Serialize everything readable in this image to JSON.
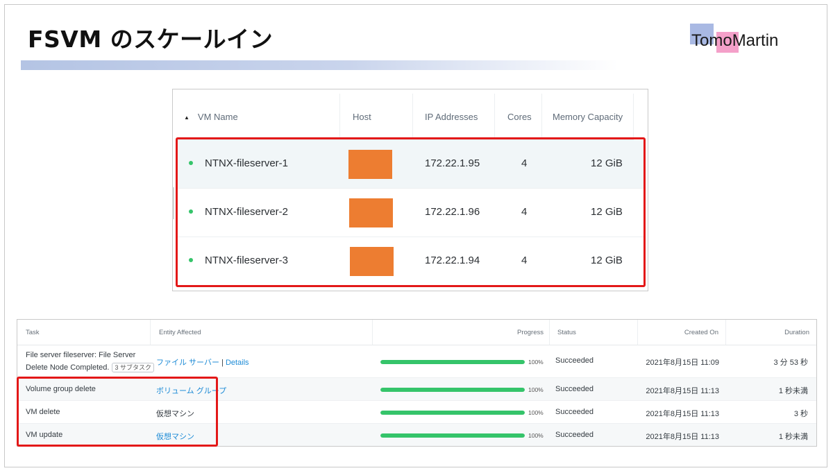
{
  "slide": {
    "title": "FSVM のスケールイン",
    "logo_text": "TomoMartin",
    "accent_color": "#b4c4e4",
    "highlight_color": "#e31818"
  },
  "vm_table": {
    "columns": [
      "VM Name",
      "Host",
      "IP Addresses",
      "Cores",
      "Memory Capacity"
    ],
    "sort_indicator": "▲",
    "host_redaction_color": "#ed7d31",
    "rows": [
      {
        "name": "NTNX-fileserver-1",
        "ip": "172.22.1.95",
        "cores": "4",
        "memory": "12 GiB",
        "status_color": "#35c46a"
      },
      {
        "name": "NTNX-fileserver-2",
        "ip": "172.22.1.96",
        "cores": "4",
        "memory": "12 GiB",
        "status_color": "#35c46a"
      },
      {
        "name": "NTNX-fileserver-3",
        "ip": "172.22.1.94",
        "cores": "4",
        "memory": "12 GiB",
        "status_color": "#35c46a"
      }
    ]
  },
  "task_table": {
    "columns": [
      "Task",
      "Entity Affected",
      "Progress",
      "Status",
      "Created On",
      "Duration"
    ],
    "rows": [
      {
        "task_line1": "File server fileserver: File Server",
        "task_line2": "Delete Node Completed.",
        "subtasks": "3 サブタスク",
        "entity": "ファイル サーバー",
        "entity_sep": "|",
        "entity_extra": "Details",
        "progress": 100,
        "progress_label": "100%",
        "status": "Succeeded",
        "created": "2021年8月15日 11:09",
        "duration": "3 分 53 秒"
      },
      {
        "task_line1": "Volume group delete",
        "entity": "ボリューム グループ",
        "entity_link": true,
        "progress": 100,
        "progress_label": "100%",
        "status": "Succeeded",
        "created": "2021年8月15日 11:13",
        "duration": "1 秒未満"
      },
      {
        "task_line1": "VM delete",
        "entity": "仮想マシン",
        "entity_link": false,
        "progress": 100,
        "progress_label": "100%",
        "status": "Succeeded",
        "created": "2021年8月15日 11:13",
        "duration": "3 秒"
      },
      {
        "task_line1": "VM update",
        "entity": "仮想マシン",
        "entity_link": true,
        "progress": 100,
        "progress_label": "100%",
        "status": "Succeeded",
        "created": "2021年8月15日 11:13",
        "duration": "1 秒未満"
      }
    ]
  }
}
